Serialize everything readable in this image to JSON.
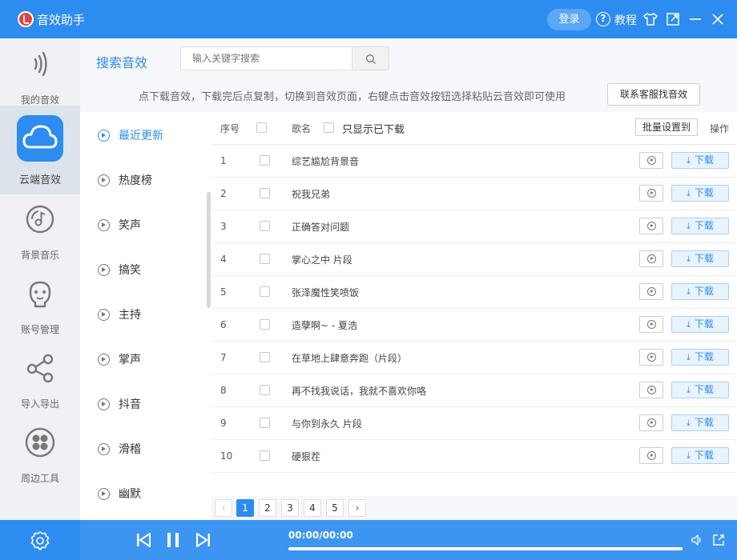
{
  "titlebar": {
    "app_title": "音效助手",
    "login_label": "登录",
    "tutorial_label": "教程",
    "brand_color": "#2d8cf0"
  },
  "sidebar": {
    "items": [
      {
        "label": "我的音效",
        "icon": "sound-wave-icon"
      },
      {
        "label": "云端音效",
        "icon": "cloud-icon",
        "active": true
      },
      {
        "label": "背景音乐",
        "icon": "music-disc-icon"
      },
      {
        "label": "账号管理",
        "icon": "user-face-icon"
      },
      {
        "label": "导入导出",
        "icon": "share-nodes-icon"
      },
      {
        "label": "周边工具",
        "icon": "tools-clover-icon"
      }
    ]
  },
  "search": {
    "title": "搜索音效",
    "placeholder": "输入关键字搜索",
    "hint": "点下载音效，下载完后点复制，切换到音效页面，右键点击音效按钮选择粘贴云音效即可使用",
    "contact_label": "联系客服找音效"
  },
  "categories": [
    {
      "label": "最近更新",
      "active": true
    },
    {
      "label": "热度榜"
    },
    {
      "label": "笑声"
    },
    {
      "label": "搞笑"
    },
    {
      "label": "主持"
    },
    {
      "label": "掌声"
    },
    {
      "label": "抖音"
    },
    {
      "label": "滑稽"
    },
    {
      "label": "幽默"
    }
  ],
  "table": {
    "col_index": "序号",
    "col_name": "歌名",
    "only_downloaded_label": "只显示已下载",
    "batch_label": "批量设置到",
    "col_action": "操作",
    "download_label": "下载",
    "rows": [
      {
        "index": "1",
        "name": "综艺尴尬背景音"
      },
      {
        "index": "2",
        "name": "祝我兄弟"
      },
      {
        "index": "3",
        "name": "正确答对问题"
      },
      {
        "index": "4",
        "name": "掌心之中 片段"
      },
      {
        "index": "5",
        "name": "张泽魔性笑喷饭"
      },
      {
        "index": "6",
        "name": "造孽啊~ - 夏浩"
      },
      {
        "index": "7",
        "name": "在草地上肆意奔跑（片段）"
      },
      {
        "index": "8",
        "name": "再不找我说话，我就不喜欢你咯"
      },
      {
        "index": "9",
        "name": "与你到永久 片段"
      },
      {
        "index": "10",
        "name": "硬狠茬"
      }
    ]
  },
  "pagination": {
    "prev": "‹",
    "next": "›",
    "pages": [
      "1",
      "2",
      "3",
      "4",
      "5"
    ],
    "current": "1"
  },
  "player": {
    "time": "00:00/00:00",
    "progress": 0
  }
}
